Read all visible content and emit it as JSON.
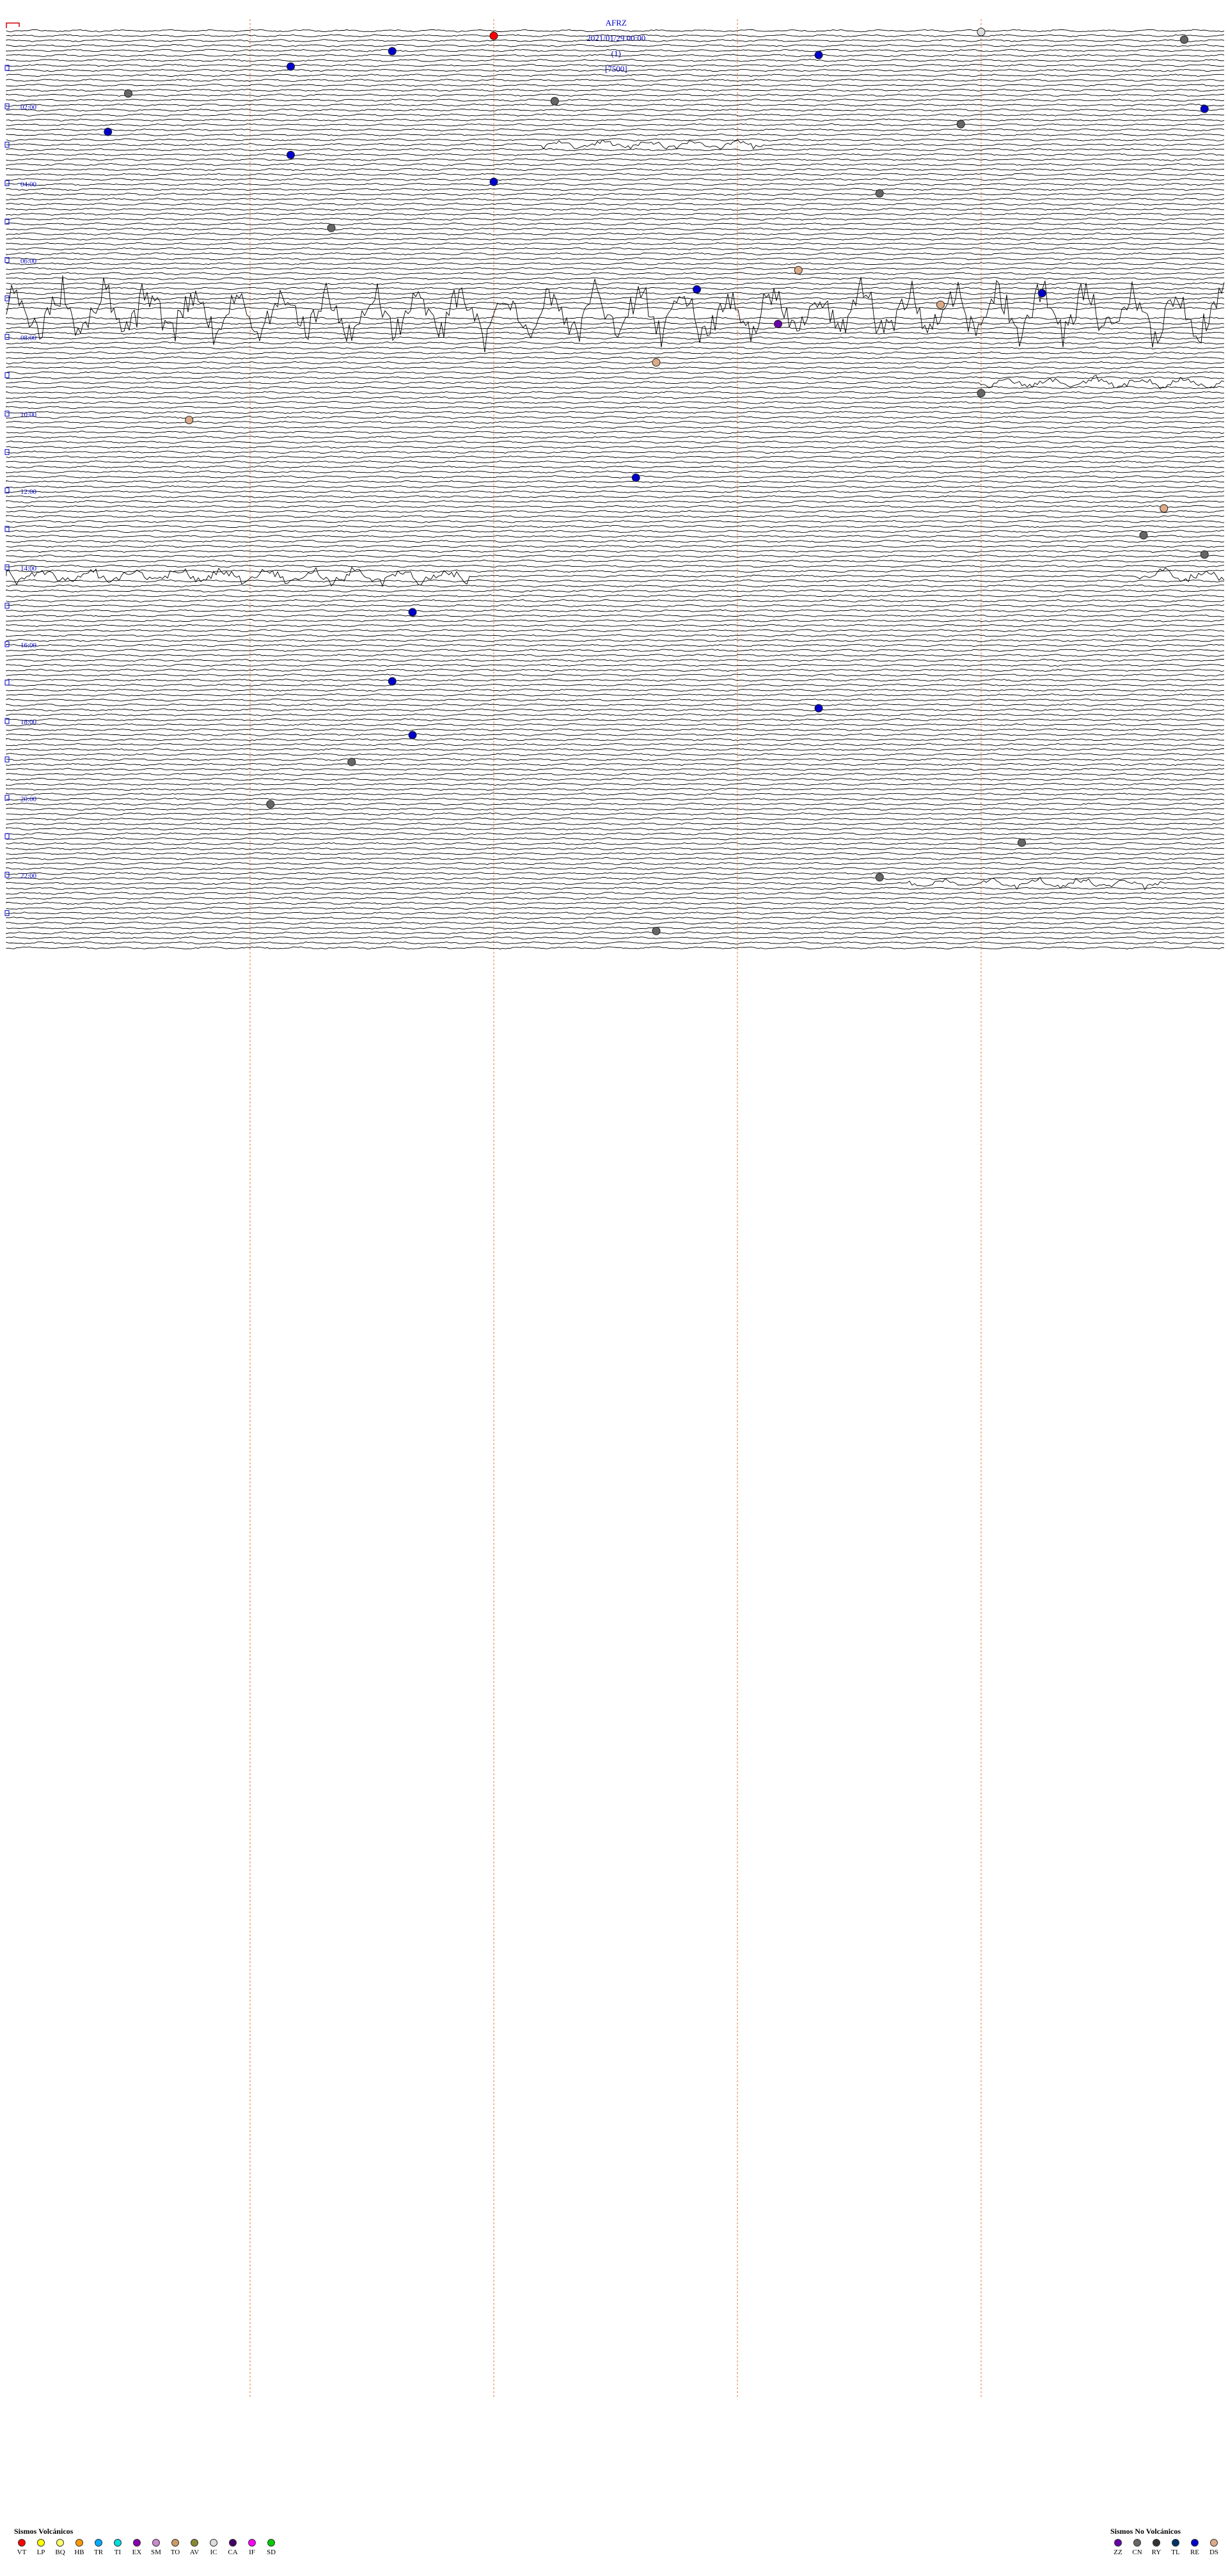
{
  "header": {
    "station": "AFRZ",
    "datetime": "2021/01/29 00:00",
    "channel": "(1)",
    "scale": "[7500]"
  },
  "colors": {
    "label_blue": "#0000cc",
    "trace": "#000000",
    "minute_marker": "#e07a3c",
    "start_marker": "#cc0000"
  },
  "chart_data": {
    "type": "helicorder",
    "title": "AFRZ 2021/01/29 00:00 (1) [7500]",
    "traces_per_hour": 4,
    "hours": 24,
    "time_labels": [
      "02:00",
      "04:00",
      "06:00",
      "08:00",
      "10:00",
      "12:00",
      "14:00",
      "16:00",
      "18:00",
      "20:00",
      "22:00"
    ],
    "noisy_segments": [
      {
        "hour_start": 3.0,
        "from_fraction": 0.44,
        "to_fraction": 0.62,
        "amp": 9
      },
      {
        "hour_start": 7.3,
        "from_fraction": 0.0,
        "to_fraction": 1.0,
        "amp": 55
      },
      {
        "hour_start": 9.2,
        "from_fraction": 0.8,
        "to_fraction": 1.0,
        "amp": 10
      },
      {
        "hour_start": 14.2,
        "from_fraction": 0.0,
        "to_fraction": 0.38,
        "amp": 16
      },
      {
        "hour_start": 14.2,
        "from_fraction": 0.93,
        "to_fraction": 1.0,
        "amp": 14
      },
      {
        "hour_start": 22.2,
        "from_fraction": 0.74,
        "to_fraction": 0.95,
        "amp": 9
      }
    ],
    "events": [
      {
        "hour": 0.1,
        "minute": 24,
        "type": "VT"
      },
      {
        "hour": 0.0,
        "minute": 48,
        "type": "IC"
      },
      {
        "hour": 0.2,
        "minute": 58,
        "type": "CN"
      },
      {
        "hour": 0.5,
        "minute": 19,
        "type": "RE"
      },
      {
        "hour": 0.6,
        "minute": 40,
        "type": "RE"
      },
      {
        "hour": 0.9,
        "minute": 14,
        "type": "RE"
      },
      {
        "hour": 1.6,
        "minute": 6,
        "type": "CN"
      },
      {
        "hour": 1.8,
        "minute": 27,
        "type": "CN"
      },
      {
        "hour": 2.0,
        "minute": 59,
        "type": "RE"
      },
      {
        "hour": 2.4,
        "minute": 47,
        "type": "CN"
      },
      {
        "hour": 2.6,
        "minute": 5,
        "type": "RE"
      },
      {
        "hour": 3.2,
        "minute": 14,
        "type": "RE"
      },
      {
        "hour": 3.9,
        "minute": 24,
        "type": "RE"
      },
      {
        "hour": 4.2,
        "minute": 43,
        "type": "CN"
      },
      {
        "hour": 5.1,
        "minute": 16,
        "type": "CN"
      },
      {
        "hour": 6.2,
        "minute": 39,
        "type": "DS"
      },
      {
        "hour": 6.7,
        "minute": 34,
        "type": "RE"
      },
      {
        "hour": 6.8,
        "minute": 51,
        "type": "RE"
      },
      {
        "hour": 7.1,
        "minute": 46,
        "type": "DS"
      },
      {
        "hour": 7.6,
        "minute": 38,
        "type": "ZZ"
      },
      {
        "hour": 8.6,
        "minute": 32,
        "type": "DS"
      },
      {
        "hour": 9.4,
        "minute": 48,
        "type": "CN"
      },
      {
        "hour": 10.1,
        "minute": 9,
        "type": "DS"
      },
      {
        "hour": 11.6,
        "minute": 31,
        "type": "RE"
      },
      {
        "hour": 12.4,
        "minute": 57,
        "type": "DS"
      },
      {
        "hour": 13.1,
        "minute": 56,
        "type": "CN"
      },
      {
        "hour": 13.6,
        "minute": 59,
        "type": "CN"
      },
      {
        "hour": 15.1,
        "minute": 20,
        "type": "RE"
      },
      {
        "hour": 16.9,
        "minute": 19,
        "type": "RE"
      },
      {
        "hour": 17.6,
        "minute": 40,
        "type": "RE"
      },
      {
        "hour": 18.3,
        "minute": 20,
        "type": "RE"
      },
      {
        "hour": 19.0,
        "minute": 17,
        "type": "CN"
      },
      {
        "hour": 20.1,
        "minute": 13,
        "type": "CN"
      },
      {
        "hour": 21.1,
        "minute": 50,
        "type": "CN"
      },
      {
        "hour": 22.0,
        "minute": 43,
        "type": "CN"
      },
      {
        "hour": 23.4,
        "minute": 32,
        "type": "CN"
      }
    ]
  },
  "legend_volcanic": {
    "title": "Sismos Volcánicos",
    "items": [
      {
        "label": "VT",
        "color": "#ff0000"
      },
      {
        "label": "LP",
        "color": "#ffff00"
      },
      {
        "label": "BQ",
        "color": "#ffff66"
      },
      {
        "label": "HB",
        "color": "#ff9900"
      },
      {
        "label": "TR",
        "color": "#00aaff"
      },
      {
        "label": "TI",
        "color": "#00dddd"
      },
      {
        "label": "EX",
        "color": "#8800aa"
      },
      {
        "label": "SM",
        "color": "#cc88cc"
      },
      {
        "label": "TO",
        "color": "#cc9966"
      },
      {
        "label": "AV",
        "color": "#888833"
      },
      {
        "label": "IC",
        "color": "#dddddd"
      },
      {
        "label": "CA",
        "color": "#440066"
      },
      {
        "label": "IF",
        "color": "#ff00ff"
      },
      {
        "label": "SD",
        "color": "#00cc00"
      }
    ]
  },
  "legend_nonvolcanic": {
    "title": "Sismos No Volcánicos",
    "items": [
      {
        "label": "ZZ",
        "color": "#6600aa"
      },
      {
        "label": "CN",
        "color": "#666666"
      },
      {
        "label": "RY",
        "color": "#333333"
      },
      {
        "label": "TL",
        "color": "#003366"
      },
      {
        "label": "RE",
        "color": "#0000cc"
      },
      {
        "label": "DS",
        "color": "#ddaa88"
      }
    ]
  }
}
